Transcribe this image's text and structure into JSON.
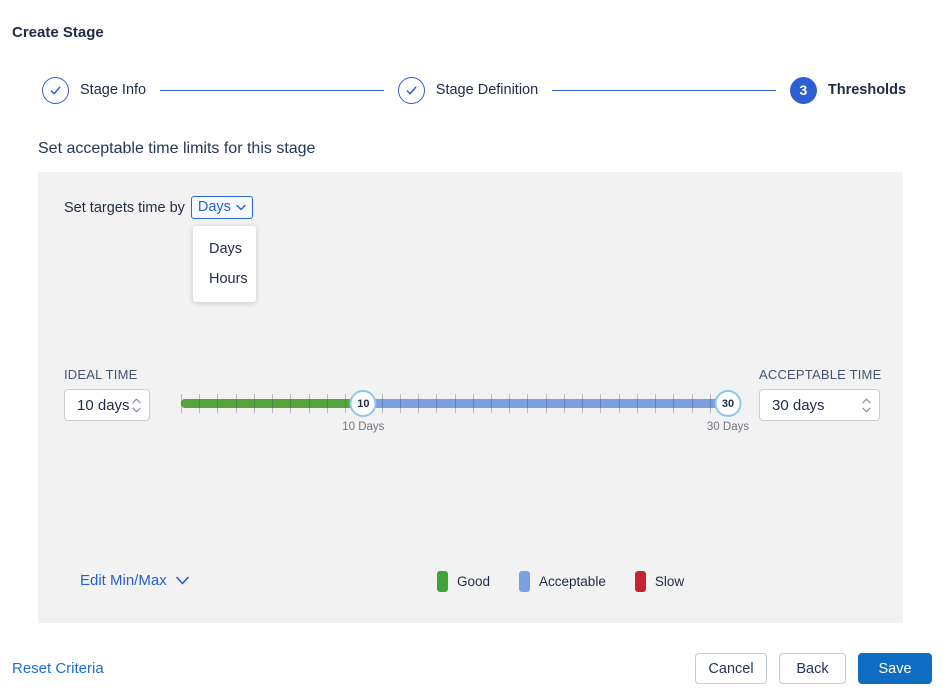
{
  "title": "Create Stage",
  "stepper": {
    "steps": [
      {
        "label": "Stage Info",
        "state": "done"
      },
      {
        "label": "Stage Definition",
        "state": "done"
      },
      {
        "label": "Thresholds",
        "state": "active",
        "number": "3"
      }
    ]
  },
  "heading": "Set acceptable time limits for this stage",
  "panel": {
    "target_label": "Set targets time by",
    "target_select": {
      "value": "Days",
      "options": [
        "Days",
        "Hours"
      ]
    },
    "ideal": {
      "label": "IDEAL TIME",
      "value": "10 days"
    },
    "acceptable": {
      "label": "ACCEPTABLE TIME",
      "value": "30 days"
    },
    "slider": {
      "min": 0,
      "max": 30,
      "handles": [
        {
          "value": 10,
          "display": "10",
          "label": "10 Days"
        },
        {
          "value": 30,
          "display": "30",
          "label": "30 Days"
        }
      ],
      "segments": [
        {
          "from": 0,
          "to": 10,
          "color": "#58a43c"
        },
        {
          "from": 10,
          "to": 30,
          "color": "#7c9fe0"
        }
      ]
    },
    "edit_minmax_label": "Edit Min/Max",
    "legend": [
      {
        "label": "Good",
        "color": "#3fa43a"
      },
      {
        "label": "Acceptable",
        "color": "#7c9fe0"
      },
      {
        "label": "Slow",
        "color": "#c62430"
      }
    ]
  },
  "footer": {
    "reset_label": "Reset Criteria",
    "cancel_label": "Cancel",
    "back_label": "Back",
    "save_label": "Save"
  },
  "colors": {
    "accent_blue": "#2d5fd2",
    "link_blue": "#1a6fd4",
    "save_blue": "#0f6cc3",
    "panel_gray": "#f2f2f2"
  }
}
